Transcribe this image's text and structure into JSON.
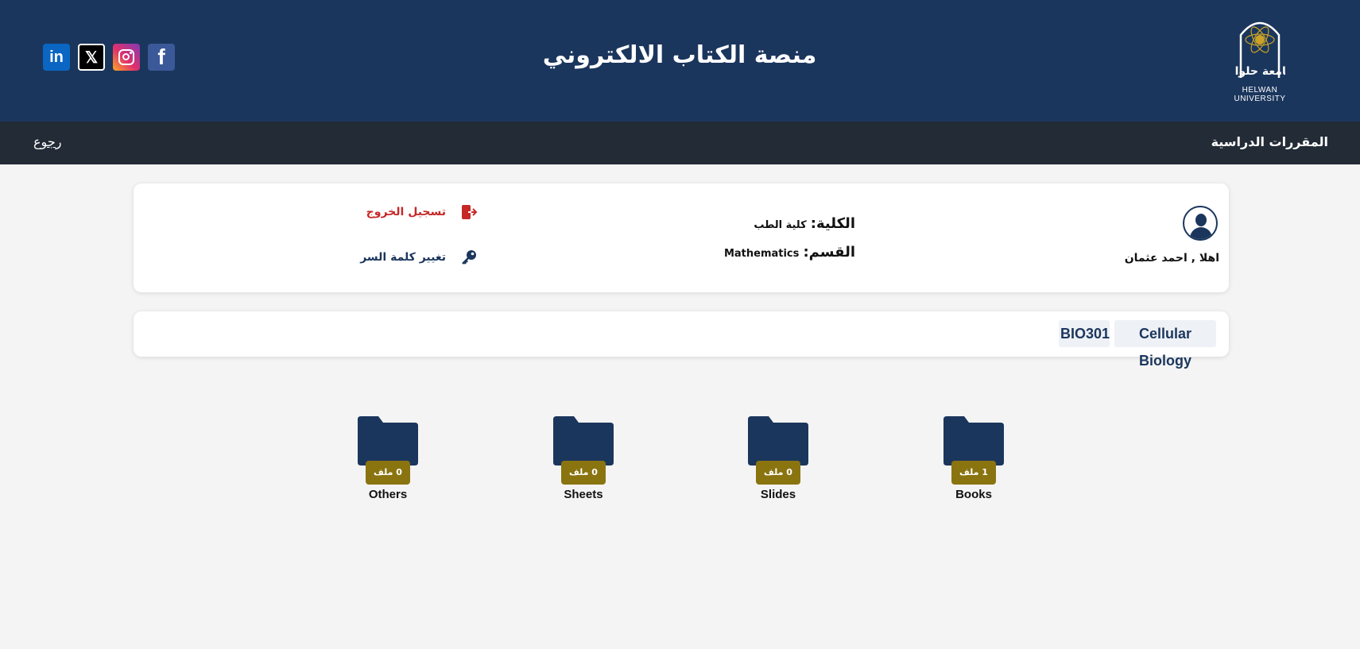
{
  "header": {
    "title": "منصة الكتاب الالكتروني",
    "logo": {
      "arabic_text": "جامعة حلوان",
      "english_text": "HELWAN UNIVERSITY"
    },
    "social": [
      {
        "name": "facebook",
        "icon": "facebook-icon",
        "glyph": "f",
        "color": "#3b5998"
      },
      {
        "name": "instagram",
        "icon": "instagram-icon",
        "color": "#e1306c"
      },
      {
        "name": "x",
        "icon": "x-icon",
        "glyph": "𝕏",
        "color": "#000000"
      },
      {
        "name": "linkedin",
        "icon": "linkedin-icon",
        "glyph": "in",
        "color": "#0a66c2"
      }
    ]
  },
  "nav": {
    "courses_label": "المقررات الدراسية",
    "back_label": "رجوع"
  },
  "user": {
    "greeting": "اهلا , احمد عثمان",
    "faculty_label": "الكلية:",
    "faculty_value": "كلية الطب",
    "department_label": "القسم:",
    "department_value": "Mathematics",
    "logout_label": "تسجيل الخروج",
    "change_password_label": "تغيير كلمة السر"
  },
  "course": {
    "name": "Cellular Biology",
    "code": "BIO301"
  },
  "folders": [
    {
      "label": "Books",
      "count": "1 ملف"
    },
    {
      "label": "Slides",
      "count": "0 ملف"
    },
    {
      "label": "Sheets",
      "count": "0 ملف"
    },
    {
      "label": "Others",
      "count": "0 ملف"
    }
  ],
  "colors": {
    "header_bg": "#1b365d",
    "navbar_bg": "#222b36",
    "badge_bg": "#8a7410",
    "logout_red": "#c62828",
    "gold": "#c9a227"
  }
}
